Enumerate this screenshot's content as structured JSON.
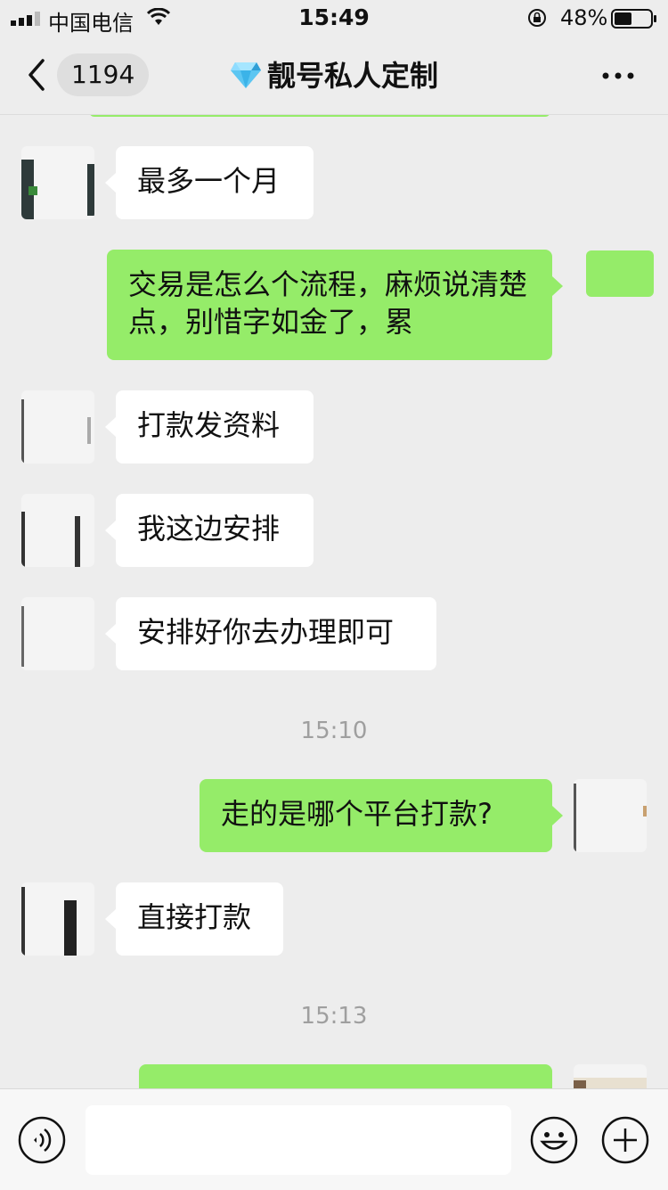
{
  "status_bar": {
    "carrier": "中国电信",
    "time": "15:49",
    "battery": "48%",
    "icons": [
      "signal-icon",
      "wifi-icon",
      "orientation-lock-icon",
      "battery-icon"
    ]
  },
  "nav": {
    "back_count": "1194",
    "title": "靓号私人定制",
    "title_icon": "diamond-icon",
    "more_icon": "more-icon"
  },
  "messages": [
    {
      "side": "left",
      "text": "最多一个月"
    },
    {
      "side": "right",
      "text": "交易是怎么个流程，麻烦说清楚点，别惜字如金了，累"
    },
    {
      "side": "left",
      "text": "打款发资料"
    },
    {
      "side": "left",
      "text": "我这边安排"
    },
    {
      "side": "left",
      "text": "安排好你去办理即可"
    },
    {
      "type": "time",
      "text": "15:10"
    },
    {
      "side": "right",
      "text": "走的是哪个平台打款?"
    },
    {
      "side": "left",
      "text": "直接打款"
    },
    {
      "type": "time",
      "text": "15:13"
    }
  ],
  "input_bar": {
    "voice_icon": "voice-icon",
    "emoji_icon": "emoji-icon",
    "plus_icon": "plus-icon",
    "placeholder": ""
  },
  "colors": {
    "background": "#ededed",
    "bubble_sent": "#95ec69",
    "bubble_received": "#ffffff",
    "timestamp": "#9f9f9f"
  }
}
